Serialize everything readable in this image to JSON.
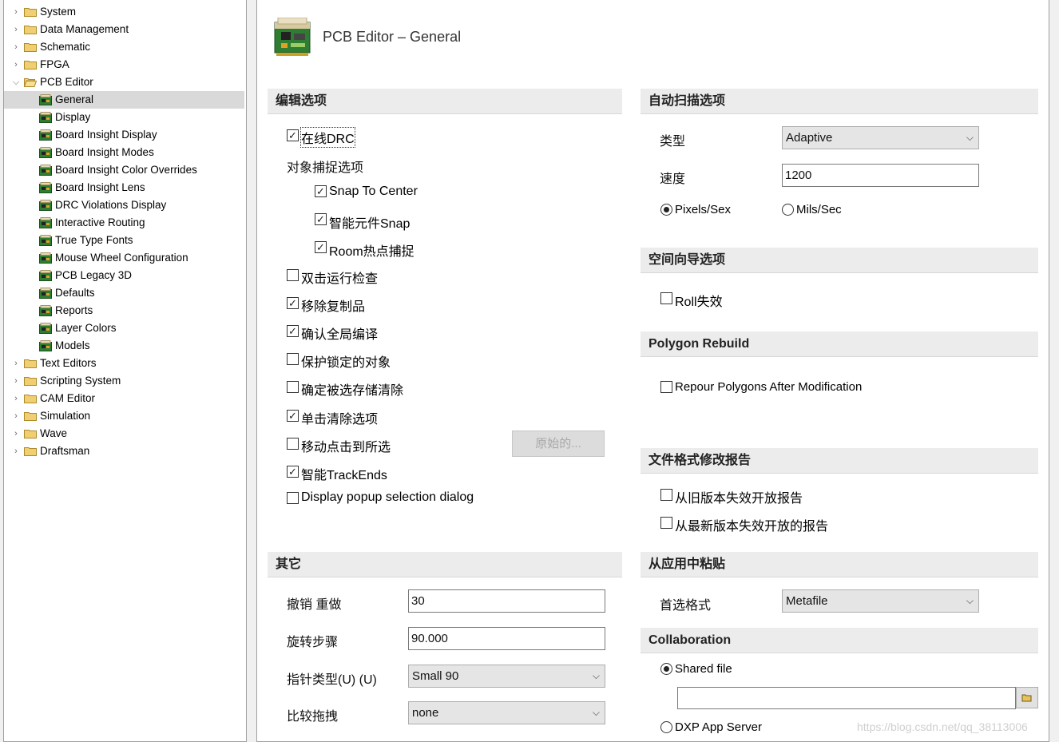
{
  "tree": {
    "items": [
      {
        "label": "System",
        "type": "folder",
        "level": 0,
        "expanded": false
      },
      {
        "label": "Data Management",
        "type": "folder",
        "level": 0,
        "expanded": false
      },
      {
        "label": "Schematic",
        "type": "folder",
        "level": 0,
        "expanded": false
      },
      {
        "label": "FPGA",
        "type": "folder",
        "level": 0,
        "expanded": false
      },
      {
        "label": "PCB Editor",
        "type": "folder",
        "level": 0,
        "expanded": true
      },
      {
        "label": "General",
        "type": "page",
        "level": 1,
        "selected": true
      },
      {
        "label": "Display",
        "type": "page",
        "level": 1
      },
      {
        "label": "Board Insight Display",
        "type": "page",
        "level": 1
      },
      {
        "label": "Board Insight Modes",
        "type": "page",
        "level": 1
      },
      {
        "label": "Board Insight Color Overrides",
        "type": "page",
        "level": 1
      },
      {
        "label": "Board Insight Lens",
        "type": "page",
        "level": 1
      },
      {
        "label": "DRC Violations Display",
        "type": "page",
        "level": 1
      },
      {
        "label": "Interactive Routing",
        "type": "page",
        "level": 1
      },
      {
        "label": "True Type Fonts",
        "type": "page",
        "level": 1
      },
      {
        "label": "Mouse Wheel Configuration",
        "type": "page",
        "level": 1
      },
      {
        "label": "PCB Legacy 3D",
        "type": "page",
        "level": 1
      },
      {
        "label": "Defaults",
        "type": "page",
        "level": 1
      },
      {
        "label": "Reports",
        "type": "page",
        "level": 1
      },
      {
        "label": "Layer Colors",
        "type": "page",
        "level": 1
      },
      {
        "label": "Models",
        "type": "page",
        "level": 1
      },
      {
        "label": "Text Editors",
        "type": "folder",
        "level": 0,
        "expanded": false
      },
      {
        "label": "Scripting System",
        "type": "folder",
        "level": 0,
        "expanded": false
      },
      {
        "label": "CAM Editor",
        "type": "folder",
        "level": 0,
        "expanded": false
      },
      {
        "label": "Simulation",
        "type": "folder",
        "level": 0,
        "expanded": false
      },
      {
        "label": "Wave",
        "type": "folder",
        "level": 0,
        "expanded": false
      },
      {
        "label": "Draftsman",
        "type": "folder",
        "level": 0,
        "expanded": false
      }
    ]
  },
  "page": {
    "title": "PCB Editor – General"
  },
  "edit": {
    "header": "编辑选项",
    "online_drc": {
      "label": "在线DRC",
      "checked": true
    },
    "snap_group_label": "对象捕捉选项",
    "snap_center": {
      "label": "Snap To Center",
      "checked": true
    },
    "smart_snap": {
      "label": "智能元件Snap",
      "checked": true
    },
    "room_hotspot": {
      "label": "Room热点捕捉",
      "checked": true
    },
    "double_click": {
      "label": "双击运行检查",
      "checked": false
    },
    "remove_dup": {
      "label": "移除复制品",
      "checked": true
    },
    "confirm_global": {
      "label": "确认全局编译",
      "checked": true
    },
    "protect_locked": {
      "label": "保护锁定的对象",
      "checked": false
    },
    "confirm_clear": {
      "label": "确定被选存储清除",
      "checked": false
    },
    "click_clear": {
      "label": "单击清除选项",
      "checked": true
    },
    "move_click": {
      "label": "移动点击到所选",
      "checked": false
    },
    "original_button": "原始的...",
    "smart_trackends": {
      "label": "智能TrackEnds",
      "checked": true
    },
    "popup_dialog": {
      "label": "Display popup selection dialog",
      "checked": false
    }
  },
  "other": {
    "header": "其它",
    "undo_label": "撤销 重做",
    "undo_value": "30",
    "rotation_label": "旋转步骤",
    "rotation_value": "90.000",
    "cursor_label": "指针类型(U) (U)",
    "cursor_value": "Small 90",
    "drag_label": "比较拖拽",
    "drag_value": "none"
  },
  "autopan": {
    "header": "自动扫描选项",
    "type_label": "类型",
    "type_value": "Adaptive",
    "speed_label": "速度",
    "speed_value": "1200",
    "pixels_label": "Pixels/Sex",
    "pixels_selected": true,
    "mils_label": "Mils/Sec",
    "mils_selected": false
  },
  "space_nav": {
    "header": "空间向导选项",
    "roll": {
      "label": "Roll失效",
      "checked": false
    }
  },
  "polygon": {
    "header": "Polygon Rebuild",
    "repour": {
      "label": "Repour Polygons After Modification",
      "checked": false
    }
  },
  "file_format": {
    "header": "文件格式修改报告",
    "old_version": {
      "label": "从旧版本失效开放报告",
      "checked": false
    },
    "new_version": {
      "label": "从最新版本失效开放的报告",
      "checked": false
    }
  },
  "paste": {
    "header": "从应用中粘贴",
    "format_label": "首选格式",
    "format_value": "Metafile"
  },
  "collab": {
    "header": "Collaboration",
    "shared_label": "Shared file",
    "shared_selected": true,
    "path_value": "",
    "dxp_label": "DXP App Server",
    "dxp_selected": false
  },
  "watermark": "https://blog.csdn.net/qq_38113006",
  "colors": {
    "selected_row": "#d9d9d9",
    "section_bg": "#ececec",
    "folder": "#e8b94a"
  }
}
